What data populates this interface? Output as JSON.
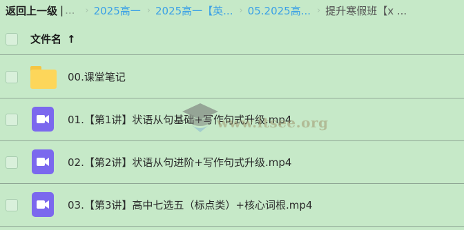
{
  "breadcrumb": {
    "back_label": "返回上一级",
    "separator": "|",
    "ellipsis": "...",
    "items": [
      "2025高一",
      "2025高一【英...",
      "05.2025高...",
      "提升寒假班【x ..."
    ],
    "arrow_glyph": "›"
  },
  "header": {
    "title": "文件名",
    "sort_glyph": "↑"
  },
  "files": [
    {
      "name": "00.课堂笔记",
      "icon": "folder-icon"
    },
    {
      "name": "01.【第1讲】状语从句基础+写作句式升级.mp4",
      "icon": "video-file-icon"
    },
    {
      "name": "02.【第2讲】状语从句进阶+写作句式升级.mp4",
      "icon": "video-file-icon"
    },
    {
      "name": "03.【第3讲】高中七选五（标点类）+核心词根.mp4",
      "icon": "video-file-icon"
    }
  ],
  "watermark": {
    "text": "www.itsee.org"
  },
  "colors": {
    "background": "#c6e9c8",
    "link": "#3aa0e6",
    "folder": "#fdd65a",
    "video": "#7b68ee",
    "divider": "#8fa795"
  }
}
